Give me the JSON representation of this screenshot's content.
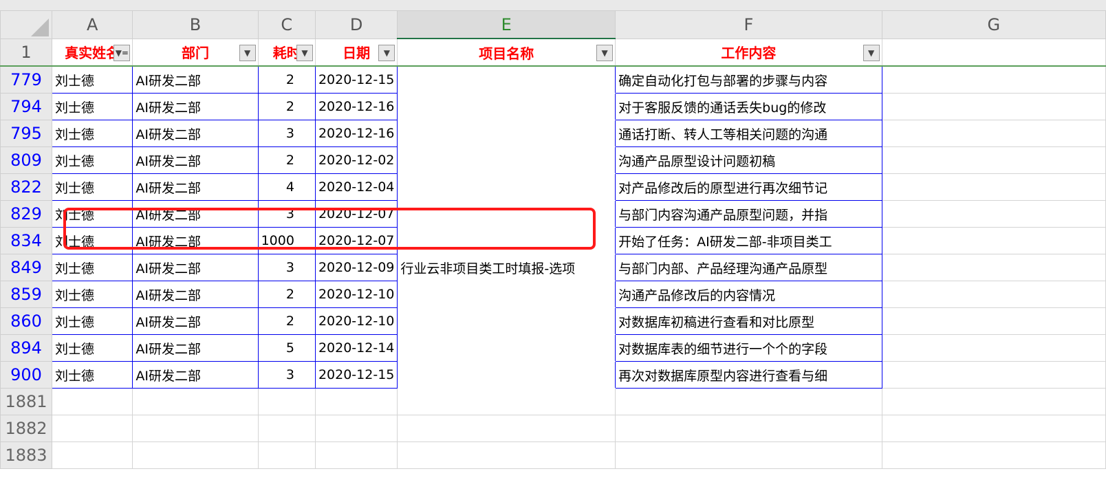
{
  "columns": [
    "A",
    "B",
    "C",
    "D",
    "E",
    "F",
    "G"
  ],
  "header_row": {
    "row": "1",
    "cells": [
      "真实姓名",
      "部门",
      "耗时",
      "日期",
      "项目名称",
      "工作内容"
    ],
    "filter_active_col": 0
  },
  "rows": [
    {
      "row": "779",
      "name": "刘士德",
      "dept": "AI研发二部",
      "hours": "2",
      "date": "2020-12-15",
      "project": "",
      "content": "确定自动化打包与部署的步骤与内容"
    },
    {
      "row": "794",
      "name": "刘士德",
      "dept": "AI研发二部",
      "hours": "2",
      "date": "2020-12-16",
      "project": "",
      "content": "对于客服反馈的通话丢失bug的修改"
    },
    {
      "row": "795",
      "name": "刘士德",
      "dept": "AI研发二部",
      "hours": "3",
      "date": "2020-12-16",
      "project": "",
      "content": "通话打断、转人工等相关问题的沟通"
    },
    {
      "row": "809",
      "name": "刘士德",
      "dept": "AI研发二部",
      "hours": "2",
      "date": "2020-12-02",
      "project": "",
      "content": "沟通产品原型设计问题初稿"
    },
    {
      "row": "822",
      "name": "刘士德",
      "dept": "AI研发二部",
      "hours": "4",
      "date": "2020-12-04",
      "project": "",
      "content": "对产品修改后的原型进行再次细节记"
    },
    {
      "row": "829",
      "name": "刘士德",
      "dept": "AI研发二部",
      "hours": "3",
      "date": "2020-12-07",
      "project": "",
      "content": "与部门内容沟通产品原型问题，并指"
    },
    {
      "row": "834",
      "name": "刘士德",
      "dept": "AI研发二部",
      "hours": "1000",
      "date": "2020-12-07",
      "project": "",
      "content": "开始了任务：AI研发二部-非项目类工"
    },
    {
      "row": "849",
      "name": "刘士德",
      "dept": "AI研发二部",
      "hours": "3",
      "date": "2020-12-09",
      "project": "行业云非项目类工时填报-选项",
      "content": "与部门内部、产品经理沟通产品原型"
    },
    {
      "row": "859",
      "name": "刘士德",
      "dept": "AI研发二部",
      "hours": "2",
      "date": "2020-12-10",
      "project": "",
      "content": "沟通产品修改后的内容情况"
    },
    {
      "row": "860",
      "name": "刘士德",
      "dept": "AI研发二部",
      "hours": "2",
      "date": "2020-12-10",
      "project": "",
      "content": "对数据库初稿进行查看和对比原型"
    },
    {
      "row": "894",
      "name": "刘士德",
      "dept": "AI研发二部",
      "hours": "5",
      "date": "2020-12-14",
      "project": "",
      "content": "对数据库表的细节进行一个个的字段"
    },
    {
      "row": "900",
      "name": "刘士德",
      "dept": "AI研发二部",
      "hours": "3",
      "date": "2020-12-15",
      "project": "",
      "content": "再次对数据库原型内容进行查看与细"
    }
  ],
  "empty_rows": [
    "1881",
    "1882",
    "1883"
  ],
  "highlight": {
    "color": "#ff1a1a",
    "rows": [
      "829",
      "834"
    ]
  }
}
